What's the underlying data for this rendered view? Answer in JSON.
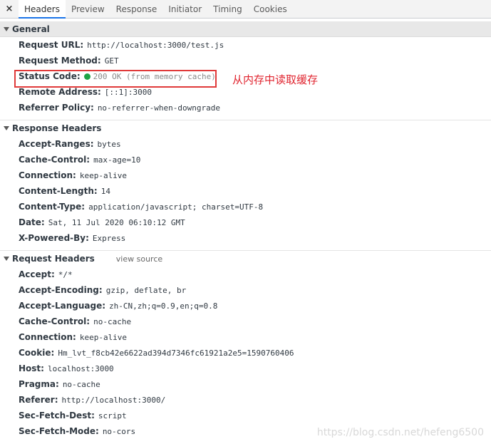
{
  "tabs": {
    "close_icon": "×",
    "items": [
      "Headers",
      "Preview",
      "Response",
      "Initiator",
      "Timing",
      "Cookies"
    ],
    "active": "Headers"
  },
  "general": {
    "title": "General",
    "request_url": {
      "key": "Request URL:",
      "value": "http://localhost:3000/test.js"
    },
    "request_method": {
      "key": "Request Method:",
      "value": "GET"
    },
    "status_code": {
      "key": "Status Code:",
      "value": "200 OK (from memory cache)",
      "status_color": "#1ea446"
    },
    "remote_address": {
      "key": "Remote Address:",
      "value": "[::1]:3000"
    },
    "referrer_policy": {
      "key": "Referrer Policy:",
      "value": "no-referrer-when-downgrade"
    }
  },
  "annotation": {
    "text": "从内存中读取缓存",
    "color": "#e0242f"
  },
  "response_headers": {
    "title": "Response Headers",
    "items": [
      {
        "key": "Accept-Ranges:",
        "value": "bytes"
      },
      {
        "key": "Cache-Control:",
        "value": "max-age=10"
      },
      {
        "key": "Connection:",
        "value": "keep-alive"
      },
      {
        "key": "Content-Length:",
        "value": "14"
      },
      {
        "key": "Content-Type:",
        "value": "application/javascript; charset=UTF-8"
      },
      {
        "key": "Date:",
        "value": "Sat, 11 Jul 2020 06:10:12 GMT"
      },
      {
        "key": "X-Powered-By:",
        "value": "Express"
      }
    ]
  },
  "request_headers": {
    "title": "Request Headers",
    "view_source": "view source",
    "items": [
      {
        "key": "Accept:",
        "value": "*/*"
      },
      {
        "key": "Accept-Encoding:",
        "value": "gzip, deflate, br"
      },
      {
        "key": "Accept-Language:",
        "value": "zh-CN,zh;q=0.9,en;q=0.8"
      },
      {
        "key": "Cache-Control:",
        "value": "no-cache"
      },
      {
        "key": "Connection:",
        "value": "keep-alive"
      },
      {
        "key": "Cookie:",
        "value": "Hm_lvt_f8cb42e6622ad394d7346fc61921a2e5=1590760406"
      },
      {
        "key": "Host:",
        "value": "localhost:3000"
      },
      {
        "key": "Pragma:",
        "value": "no-cache"
      },
      {
        "key": "Referer:",
        "value": "http://localhost:3000/"
      },
      {
        "key": "Sec-Fetch-Dest:",
        "value": "script"
      },
      {
        "key": "Sec-Fetch-Mode:",
        "value": "no-cors"
      }
    ]
  },
  "watermark": "https://blog.csdn.net/hefeng6500"
}
